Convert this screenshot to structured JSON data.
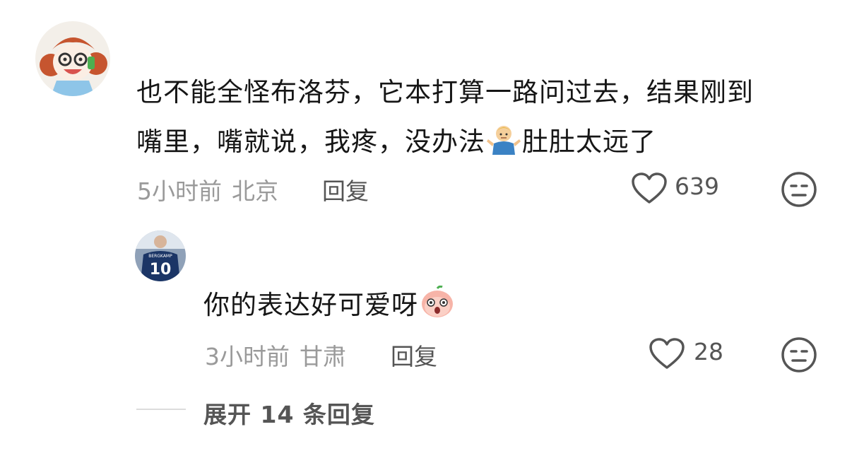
{
  "comment": {
    "text_line1": "也不能全怪布洛芬，它本打算一路问过去，结果刚到",
    "text_line2a": "嘴里，嘴就说，我疼，没办法",
    "text_line2b": "肚肚太远了",
    "emoji_inline": "person-shrugging-emoji",
    "time": "5小时前",
    "location": "北京",
    "reply_label": "回复",
    "likes": "639"
  },
  "reply": {
    "text": "你的表达好可爱呀",
    "emoji_inline": "peach-face-emoji",
    "time": "3小时前",
    "location": "甘肃",
    "reply_label": "回复",
    "likes": "28",
    "avatar_jersey_name": "BERGKAMP",
    "avatar_jersey_number": "10"
  },
  "expand_label": "展开 14 条回复",
  "colors": {
    "meta_gray": "#9a9a9a",
    "action_gray": "#555555",
    "text": "#161616"
  }
}
